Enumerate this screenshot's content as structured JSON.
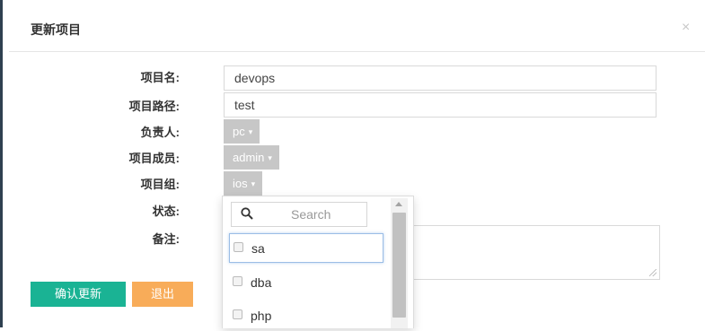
{
  "modal": {
    "title": "更新项目",
    "close_glyph": "×"
  },
  "labels": {
    "name": "项目名:",
    "path": "项目路径:",
    "owner": "负责人:",
    "members": "项目成员:",
    "group": "项目组:",
    "status": "状态:",
    "remark": "备注:"
  },
  "fields": {
    "name_value": "devops",
    "path_value": "test",
    "owner_value": "pc",
    "members_value": "admin",
    "group_value": "ios"
  },
  "dropdown": {
    "search_placeholder": "Search",
    "options": [
      {
        "label": "sa",
        "checked": false
      },
      {
        "label": "dba",
        "checked": false
      },
      {
        "label": "php",
        "checked": false
      }
    ]
  },
  "buttons": {
    "confirm": "确认更新",
    "exit": "退出"
  },
  "colors": {
    "confirm_bg": "#1ab394",
    "exit_bg": "#f8ac59",
    "dropdown_button_bg": "#c7c7c7"
  },
  "icons": [
    "close-icon",
    "search-icon",
    "caret-down-icon",
    "checkbox-icon",
    "resize-grip-icon"
  ]
}
